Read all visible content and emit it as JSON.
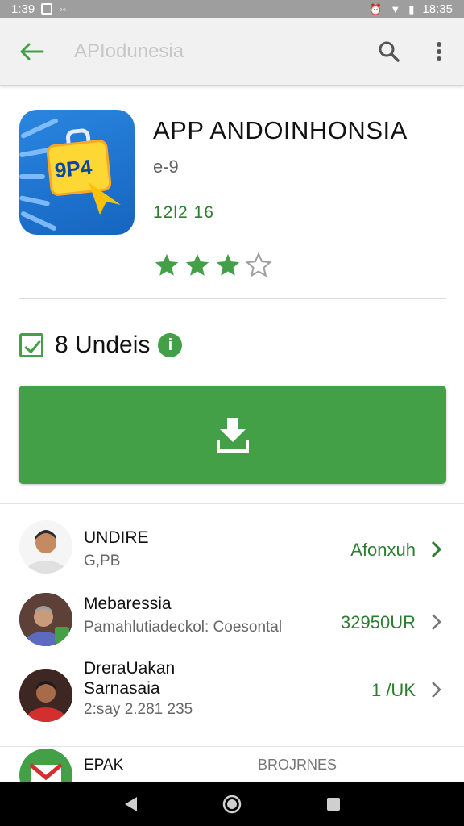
{
  "status_bar": {
    "time_left": "1:39",
    "time_right": "18:35"
  },
  "toolbar": {
    "title": "APIodunesia"
  },
  "app": {
    "title": "APP ANDOINHONSIA",
    "developer": "e-9",
    "version": "12l2 16",
    "icon_text": "9P4",
    "rating": 3.5,
    "rating_max": 5
  },
  "updates": {
    "label": "8 Undeis",
    "info_glyph": "i"
  },
  "colors": {
    "accent": "#43a047",
    "accent_text": "#2e7d32",
    "status_bar": "#9e9e9e",
    "toolbar": "#f1f1f1"
  },
  "list": [
    {
      "title": "UNDIRE",
      "subtitle": "G,PB",
      "value": "Afonxuh"
    },
    {
      "title": "Mebaressia",
      "subtitle": "Pamahlutiadeckol: Coesontal",
      "value": "32950UR"
    },
    {
      "title": "DreraUakan",
      "title2": "Sarnasaia",
      "subtitle": "2:say 2.281 235",
      "value": "1 /UK"
    }
  ],
  "bottom_item": {
    "title": "EPAK",
    "value": "BROJRNES"
  },
  "icons": {
    "back": "arrow-left-icon",
    "search": "search-icon",
    "menu": "more-vert-icon",
    "install": "download-icon",
    "nav": [
      "back-triangle-icon",
      "home-circle-icon",
      "recents-square-icon"
    ]
  }
}
